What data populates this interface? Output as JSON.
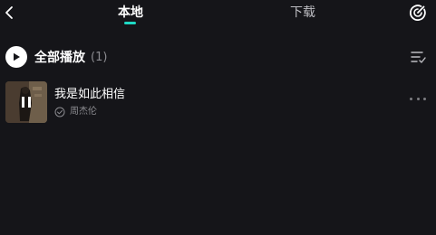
{
  "header": {
    "tabs": [
      {
        "label": "本地",
        "active": true
      },
      {
        "label": "下载",
        "active": false
      }
    ],
    "back_icon": "chevron-left-icon",
    "right_icon": "speed-dial-icon",
    "accent_color": "#1ed9c4"
  },
  "playall": {
    "label": "全部播放",
    "count": "(1)",
    "icon": "play-icon",
    "sort_icon": "sort-list-icon"
  },
  "songs": [
    {
      "title": "我是如此相信",
      "artist": "周杰伦",
      "status_icon": "downloaded-check-icon",
      "playing_icon": "pause-icon",
      "more_icon": "more-dots-icon"
    }
  ],
  "colors": {
    "background": "#151519",
    "text_primary": "#ffffff",
    "text_secondary": "#8b8b90"
  }
}
